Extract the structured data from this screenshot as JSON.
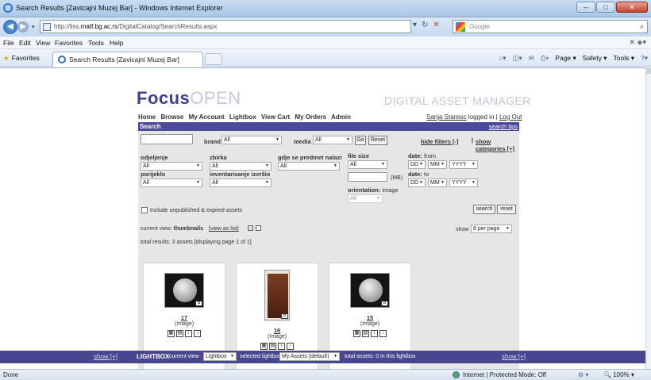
{
  "window": {
    "title": "Search Results [Zavicajni Muzej Bar] - Windows Internet Explorer",
    "url_prefix": "http://liss.",
    "url_host": "matf.bg.ac.rs",
    "url_path": "/DigitalCatalog/SearchResults.aspx",
    "search_placeholder": "Google",
    "min_label": "–",
    "max_label": "□",
    "close_label": "✕"
  },
  "menu": {
    "items": [
      "File",
      "Edit",
      "View",
      "Favorites",
      "Tools",
      "Help"
    ]
  },
  "favbar": {
    "favorites_label": "Favorites",
    "tab_title": "Search Results [Zavicajni Muzej Bar]",
    "commands": [
      "Page ▾",
      "Safety ▾",
      "Tools ▾"
    ]
  },
  "site": {
    "brand_a": "Focus",
    "brand_b": "OPEN",
    "tagline": "DIGITAL ASSET MANAGER",
    "nav": [
      "Home",
      "Browse",
      "My Account",
      "Lightbox",
      "View Cart",
      "My Orders",
      "Admin"
    ],
    "user_name": "Sanja Stanisic",
    "user_suffix": " logged in",
    "logout": "Log Out"
  },
  "search": {
    "header": "Search",
    "tips": "search tips",
    "keyword_value": "",
    "brand_label": "brand",
    "brand_value": "All",
    "media_label": "media",
    "media_value": "All",
    "go": "Go",
    "reset": "Reset",
    "hide_filters": "hide filters [-]",
    "sep": " | ",
    "show_categories": "show categories [+]",
    "odjeljenje_label": "odjeljenje",
    "odjeljenje_value": "All",
    "zbirka_label": "zbirka",
    "zbirka_value": "All",
    "gdje_label": "gdje se predmet nalazi",
    "gdje_value": "All",
    "porijeklo_label": "porijeklo",
    "porijeklo_value": "All",
    "inv_label": "inventarisanje izvršio",
    "inv_value": "All",
    "filesize_label": "file size",
    "filesize_value": "All",
    "mb_label": "(MB)",
    "orientation_label": "orientation:",
    "orientation_suffix": " image",
    "orientation_value": "All",
    "date_from_label": "date:",
    "date_from_suffix": " from",
    "date_to_label": "date:",
    "date_to_suffix": " to",
    "dd": "DD",
    "mm": "MM",
    "yyyy": "YYYY",
    "include_label": "Include unpublished & expired assets",
    "search_btn": "search",
    "reset_btn": "reset"
  },
  "results": {
    "current_view_prefix": "current view: ",
    "current_view": "thumbnails",
    "view_as_list": "[view as list]",
    "show_label": "show",
    "per_page": "8 per page",
    "total": "total results: 3 assets [displaying page 1 of 1]"
  },
  "assets": [
    {
      "num": "17",
      "type": "(Image)",
      "icon": "coin-image"
    },
    {
      "num": "16",
      "type": "(Image)",
      "icon": "cabinet-image"
    },
    {
      "num": "15",
      "type": "(Image)",
      "icon": "coin-image"
    }
  ],
  "lightbox": {
    "show_left": "show [+]",
    "title": "LIGHTBOX",
    "current_view_label": "current view",
    "current_view_value": "Lightbox",
    "selected_label": "selected lightbox",
    "selected_value": "My Assets (default)",
    "total": "total assets: 0 in this lightbox",
    "show_right": "show [+]"
  },
  "status": {
    "left": "Done",
    "zone": "Internet | Protected Mode: Off",
    "zoom": "100%"
  }
}
